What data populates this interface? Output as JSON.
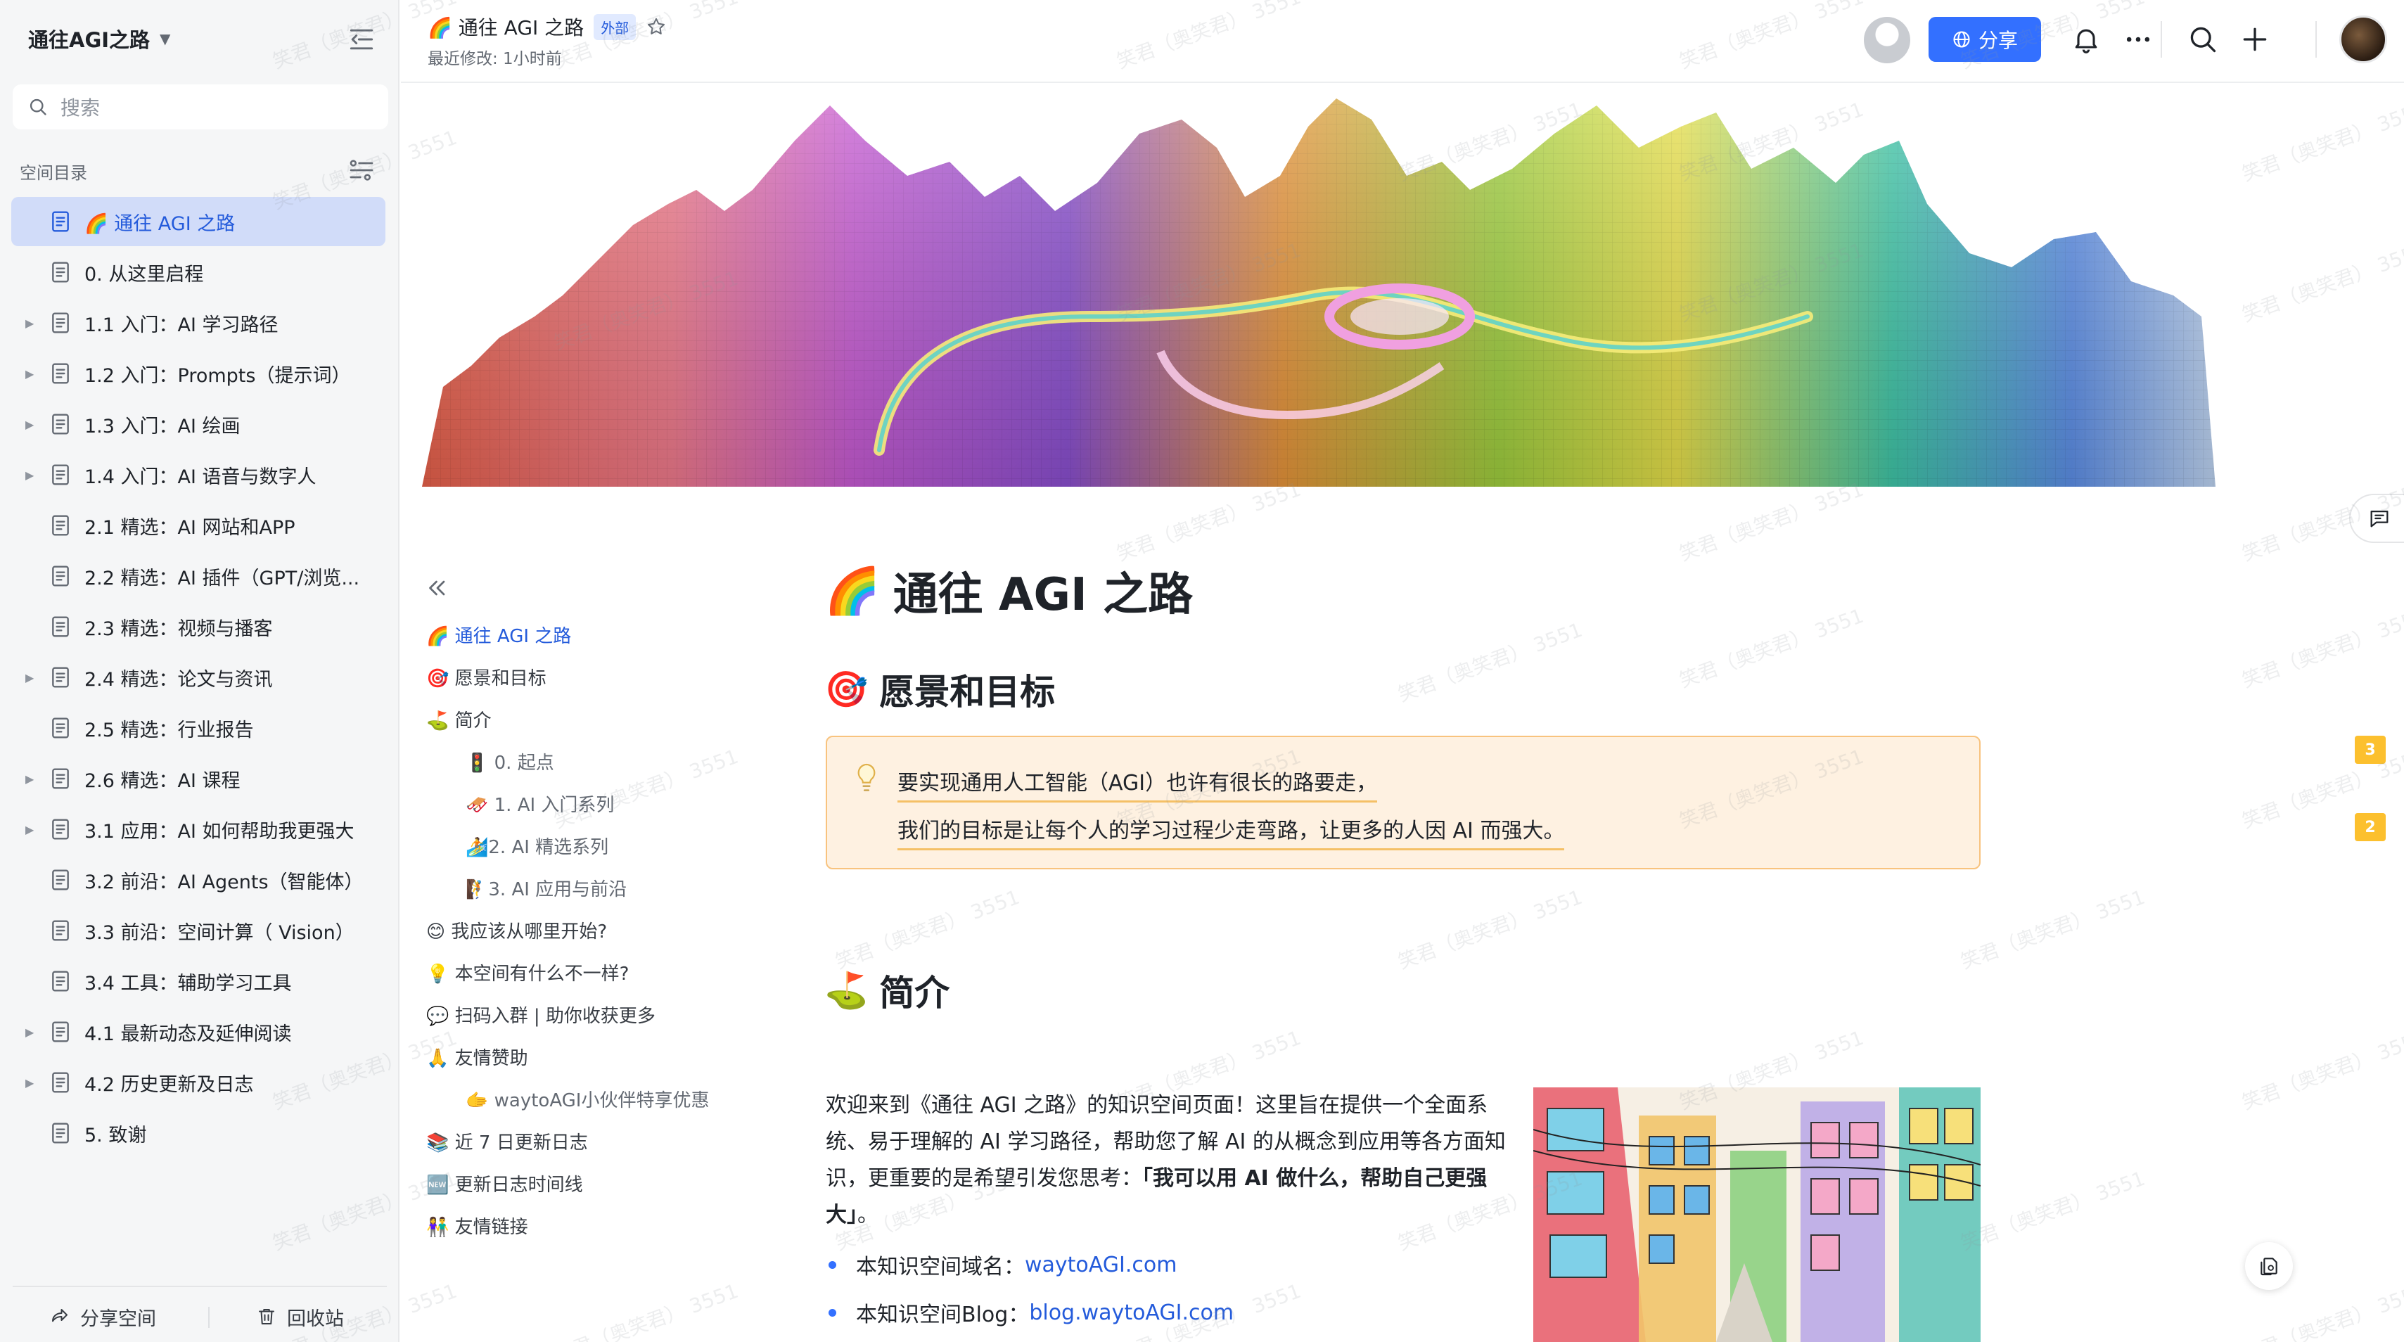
{
  "sidebar": {
    "space_title": "通往AGI之路",
    "search_placeholder": "搜索",
    "section_label": "空间目录",
    "items": [
      {
        "label": "🌈 通往 AGI 之路",
        "active": true,
        "expandable": false
      },
      {
        "label": "0. 从这里启程",
        "active": false,
        "expandable": false
      },
      {
        "label": "1.1 入门：AI 学习路径",
        "active": false,
        "expandable": true
      },
      {
        "label": "1.2 入门：Prompts（提示词）",
        "active": false,
        "expandable": true
      },
      {
        "label": "1.3 入门：AI 绘画",
        "active": false,
        "expandable": true
      },
      {
        "label": "1.4 入门：AI 语音与数字人",
        "active": false,
        "expandable": true
      },
      {
        "label": "2.1 精选：AI 网站和APP",
        "active": false,
        "expandable": false
      },
      {
        "label": "2.2 精选：AI 插件（GPT/浏览...",
        "active": false,
        "expandable": false
      },
      {
        "label": "2.3 精选：视频与播客",
        "active": false,
        "expandable": false
      },
      {
        "label": "2.4 精选：论文与资讯",
        "active": false,
        "expandable": true
      },
      {
        "label": "2.5 精选：行业报告",
        "active": false,
        "expandable": false
      },
      {
        "label": "2.6 精选：AI 课程",
        "active": false,
        "expandable": true
      },
      {
        "label": "3.1 应用：AI 如何帮助我更强大",
        "active": false,
        "expandable": true
      },
      {
        "label": "3.2 前沿：AI Agents（智能体）",
        "active": false,
        "expandable": false
      },
      {
        "label": "3.3 前沿：空间计算（ Vision）",
        "active": false,
        "expandable": false
      },
      {
        "label": "3.4 工具：辅助学习工具",
        "active": false,
        "expandable": false
      },
      {
        "label": "4.1 最新动态及延伸阅读",
        "active": false,
        "expandable": true
      },
      {
        "label": "4.2 历史更新及日志",
        "active": false,
        "expandable": true
      },
      {
        "label": "5. 致谢",
        "active": false,
        "expandable": false
      }
    ],
    "footer": {
      "share_label": "分享空间",
      "trash_label": "回收站"
    }
  },
  "topbar": {
    "doc_title": "🌈 通往 AGI 之路",
    "tag": "外部",
    "last_modified": "最近修改: 1小时前",
    "share_label": "分享"
  },
  "outline": {
    "items": [
      {
        "label": "🌈 通往 AGI 之路",
        "level": 1,
        "active": true
      },
      {
        "label": "🎯 愿景和目标",
        "level": 1,
        "active": false
      },
      {
        "label": "⛳ 简介",
        "level": 1,
        "active": false
      },
      {
        "label": "🚦 0. 起点",
        "level": 2,
        "active": false
      },
      {
        "label": "🛷 1. AI 入门系列",
        "level": 2,
        "active": false
      },
      {
        "label": "🏄2. AI 精选系列",
        "level": 2,
        "active": false
      },
      {
        "label": "🧗3. AI 应用与前沿",
        "level": 2,
        "active": false
      },
      {
        "label": "😊 我应该从哪里开始?",
        "level": 1,
        "active": false
      },
      {
        "label": "💡 本空间有什么不一样?",
        "level": 1,
        "active": false
      },
      {
        "label": "💬 扫码入群 | 助你收获更多",
        "level": 1,
        "active": false
      },
      {
        "label": "🙏 友情赞助",
        "level": 1,
        "active": false
      },
      {
        "label": "🫱 waytoAGI小伙伴特享优惠",
        "level": 2,
        "active": false
      },
      {
        "label": "📚 近 7 日更新日志",
        "level": 1,
        "active": false
      },
      {
        "label": "🆕 更新日志时间线",
        "level": 1,
        "active": false
      },
      {
        "label": "👫 友情链接",
        "level": 1,
        "active": false
      }
    ]
  },
  "doc": {
    "title_emoji": "🌈",
    "title_text": "通往 AGI 之路",
    "vision_heading_emoji": "🎯",
    "vision_heading_text": "愿景和目标",
    "callout_line1": "要实现通用人工智能（AGI）也许有很长的路要走，",
    "callout_line2": "我们的目标是让每个人的学习过程少走弯路，让更多的人因 AI 而强大。",
    "intro_heading_emoji": "⛳",
    "intro_heading_text": "简介",
    "intro_text": "欢迎来到《通往 AGI 之路》的知识空间页面！这里旨在提供一个全面系统、易于理解的 AI 学习路径，帮助您了解 AI 的从概念到应用等各方面知识，更重要的是希望引发您思考：",
    "intro_bold": "「我可以用 AI 做什么，帮助自己更强大」",
    "intro_end": "。",
    "bullet1_label": "本知识空间域名：",
    "bullet1_link": "waytoAGI.com",
    "bullet2_label": "本知识空间Blog：",
    "bullet2_link": "blog.waytoAGI.com"
  },
  "comments": {
    "badge_1": "3",
    "badge_2": "2"
  },
  "watermark_text": "笑君（奥笑君） 3551",
  "colors": {
    "accent": "#3370ff",
    "active_bg": "#d1dcf9",
    "callout_bg": "#fef1e1",
    "callout_border": "#f8c37e",
    "badge": "#fcc02e"
  }
}
